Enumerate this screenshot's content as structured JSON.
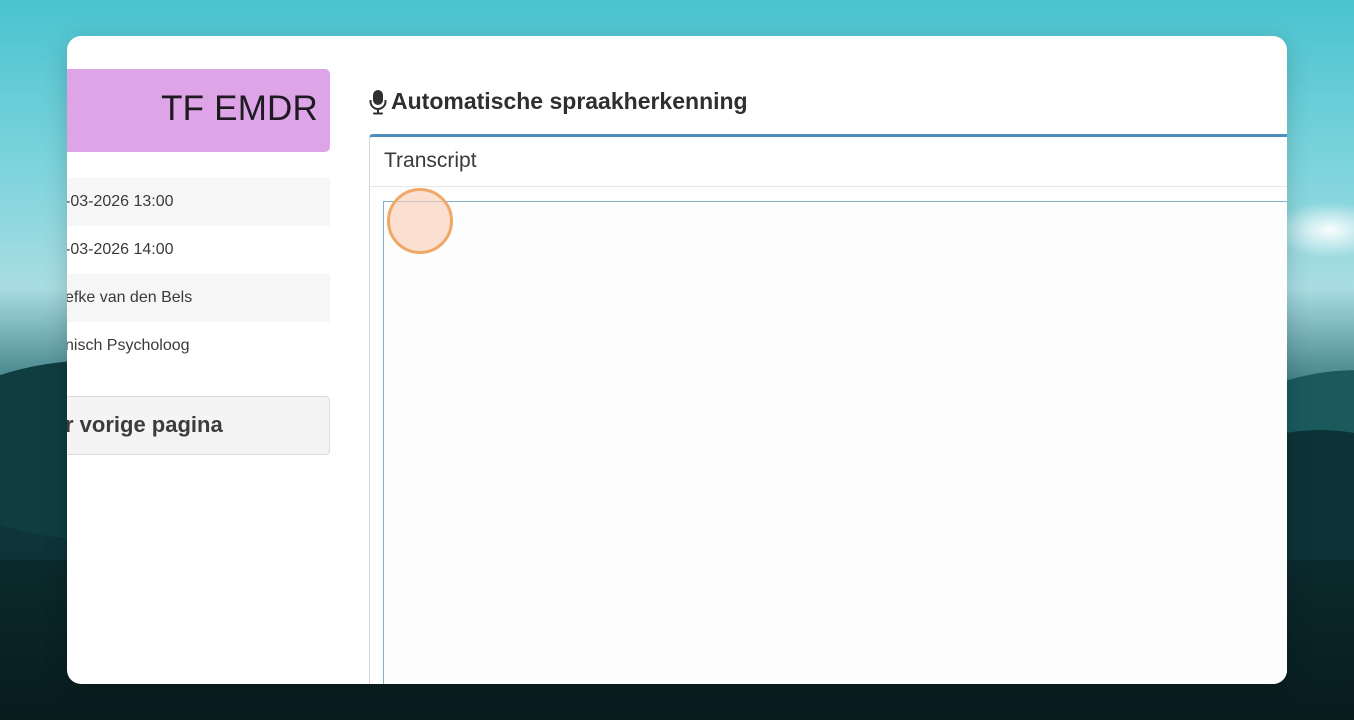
{
  "sidebar": {
    "title": "TF EMDR",
    "title_color": "#dda5e8",
    "info_rows": [
      "-03-2026 13:00",
      "-03-2026 14:00",
      "efke van den Bels",
      "nisch Psycholoog"
    ],
    "back_button_label": "r vorige pagina"
  },
  "main": {
    "section_icon": "microphone-icon",
    "section_title": "Automatische spraakherkenning",
    "panel": {
      "header": "Transcript",
      "accent_color": "#4a8fbf",
      "transcript_value": ""
    }
  }
}
